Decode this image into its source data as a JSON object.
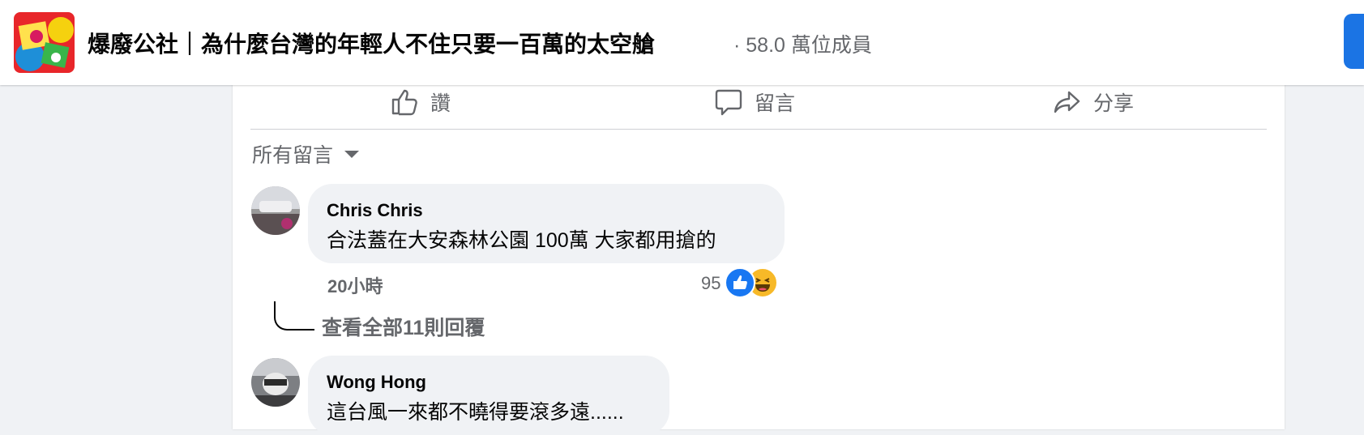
{
  "header": {
    "group_title": "爆廢公社｜為什麼台灣的年輕人不住只要一百萬的太空艙",
    "members": "· 58.0 萬位成員"
  },
  "post_actions": {
    "like_label": "讚",
    "comment_label": "留言",
    "share_label": "分享"
  },
  "comments_filter": "所有留言",
  "comments": [
    {
      "author": "Chris Chris",
      "text": "合法蓋在大安森林公園 100萬 大家都用搶的",
      "time": "20小時",
      "reaction_count": "95",
      "reactions": [
        "like-icon",
        "haha-icon"
      ],
      "view_replies": "查看全部11則回覆"
    },
    {
      "author": "Wong Hong",
      "text": "這台風一來都不曉得要滾多遠......"
    }
  ],
  "colors": {
    "accent": "#1b74e4",
    "like_blue": "#1877f2",
    "haha_yellow": "#f7b928",
    "muted_text": "#65676b",
    "bubble_bg": "#f0f2f5"
  }
}
